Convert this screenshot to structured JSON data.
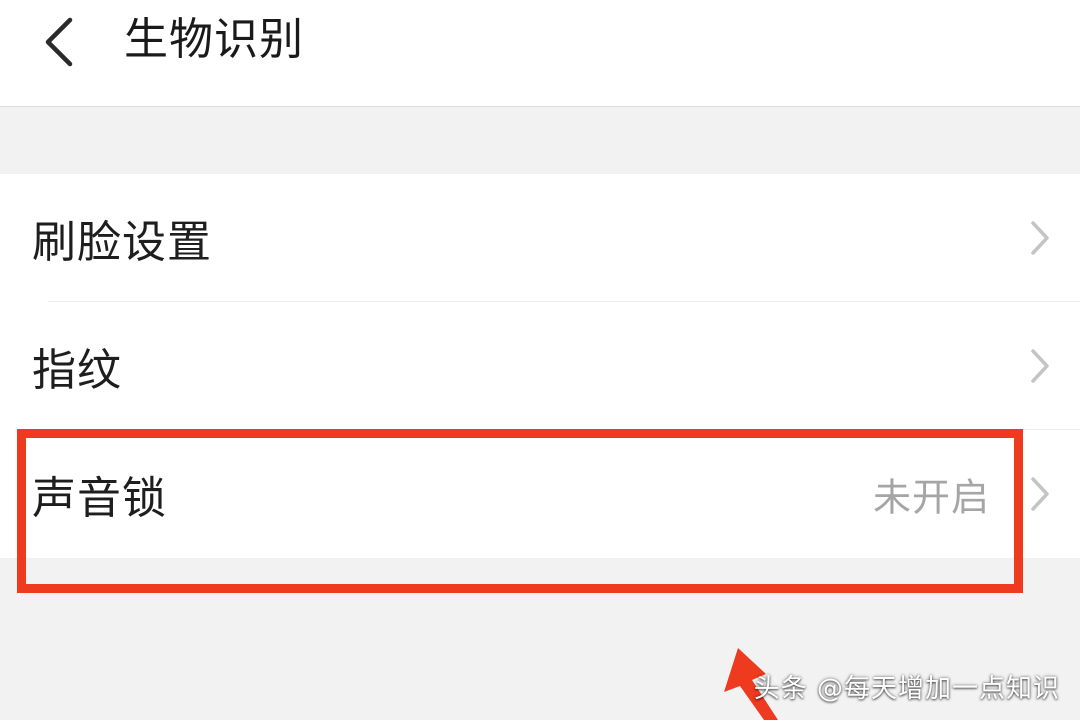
{
  "header": {
    "title": "生物识别",
    "back_icon": "chevron-left-icon"
  },
  "list": {
    "items": [
      {
        "label": "刷脸设置",
        "value": ""
      },
      {
        "label": "指纹",
        "value": ""
      },
      {
        "label": "声音锁",
        "value": "未开启"
      }
    ]
  },
  "annotation": {
    "highlight_color": "#ee3a1f",
    "arrow_color": "#ee3a1f"
  },
  "watermark": {
    "text": "头条 @每天增加一点知识"
  }
}
